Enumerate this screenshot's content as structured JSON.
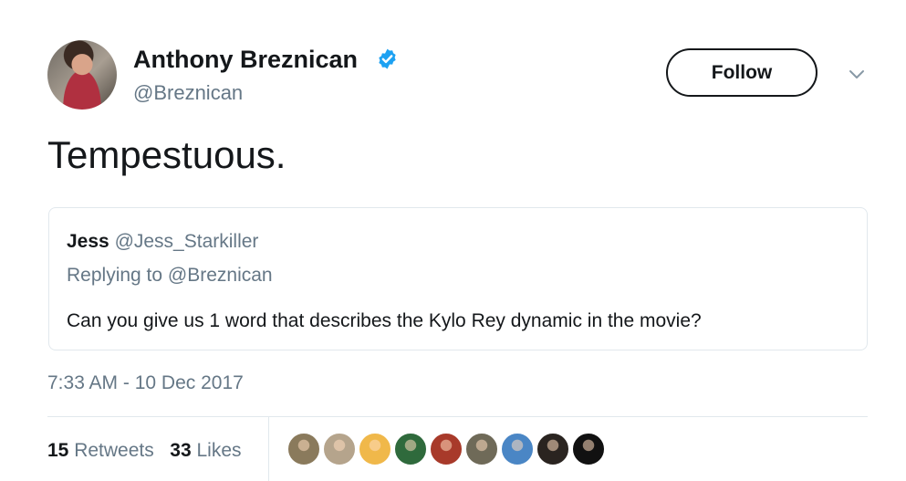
{
  "author": {
    "name": "Anthony Breznican",
    "handle": "@Breznican",
    "verified": true
  },
  "follow_label": "Follow",
  "tweet_text": "Tempestuous.",
  "quoted": {
    "name": "Jess",
    "handle": "@Jess_Starkiller",
    "replying_to": "Replying to @Breznican",
    "text": "Can you give us 1 word that describes the Kylo Rey dynamic in the movie?"
  },
  "timestamp": "7:33 AM - 10 Dec 2017",
  "stats": {
    "retweets_count": "15",
    "retweets_label": "Retweets",
    "likes_count": "33",
    "likes_label": "Likes"
  },
  "likers": [
    {
      "icon": "liker-avatar",
      "color": "#8a7a5c"
    },
    {
      "icon": "liker-avatar",
      "color": "#b5a48c"
    },
    {
      "icon": "liker-avatar",
      "color": "#f0b84a"
    },
    {
      "icon": "liker-avatar",
      "color": "#2f6a3c"
    },
    {
      "icon": "liker-avatar",
      "color": "#a83a2a"
    },
    {
      "icon": "liker-avatar",
      "color": "#6f6a58"
    },
    {
      "icon": "liker-avatar",
      "color": "#4a86c5"
    },
    {
      "icon": "liker-avatar",
      "color": "#2a2420"
    },
    {
      "icon": "liker-avatar",
      "color": "#111111"
    }
  ],
  "colors": {
    "verified_badge": "#1da1f2",
    "secondary_text": "#657786",
    "border": "#e1e8ed"
  }
}
